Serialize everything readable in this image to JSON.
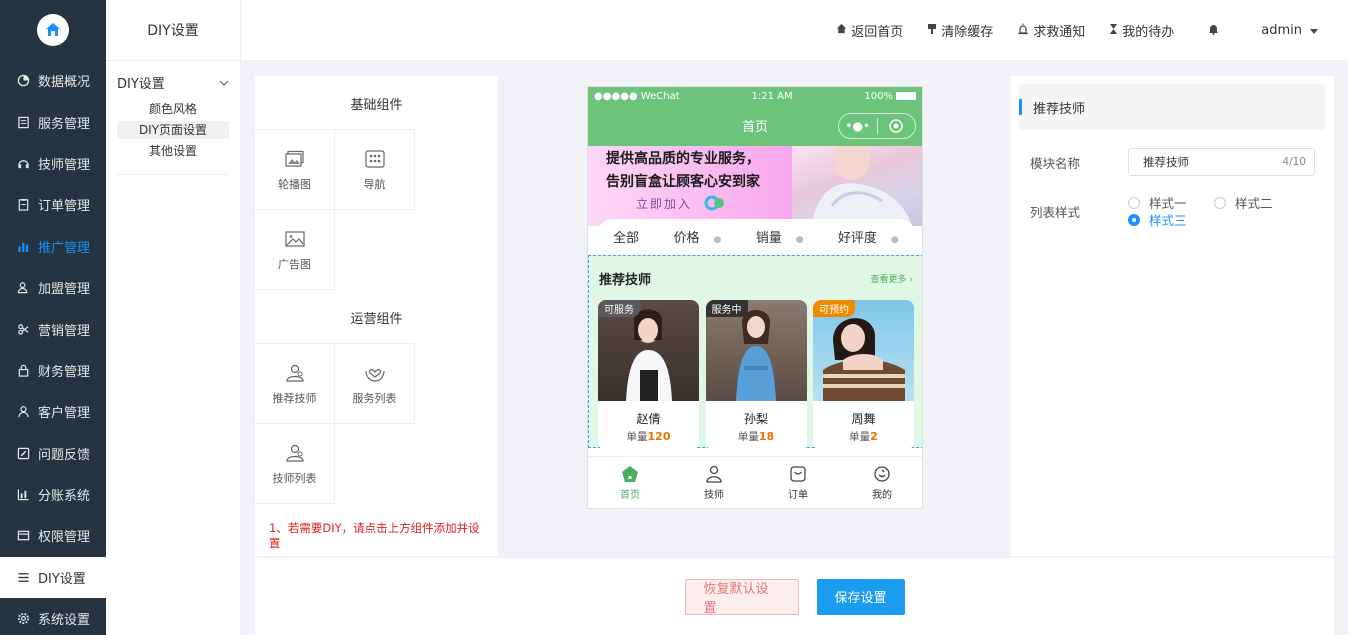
{
  "sidebar": {
    "items": [
      {
        "label": "数据概况",
        "icon": "pie-chart-icon"
      },
      {
        "label": "服务管理",
        "icon": "receipt-icon"
      },
      {
        "label": "技师管理",
        "icon": "headset-icon"
      },
      {
        "label": "订单管理",
        "icon": "clipboard-icon"
      },
      {
        "label": "推广管理",
        "icon": "bar-chart-icon"
      },
      {
        "label": "加盟管理",
        "icon": "user-group-icon"
      },
      {
        "label": "营销管理",
        "icon": "scissor-icon"
      },
      {
        "label": "财务管理",
        "icon": "lock-icon"
      },
      {
        "label": "客户管理",
        "icon": "user-icon"
      },
      {
        "label": "问题反馈",
        "icon": "edit-icon"
      },
      {
        "label": "分账系统",
        "icon": "chart-icon"
      },
      {
        "label": "权限管理",
        "icon": "card-icon"
      },
      {
        "label": "DIY设置",
        "icon": "menu-icon"
      },
      {
        "label": "系统设置",
        "icon": "gear-icon"
      }
    ]
  },
  "subnav": {
    "title": "DIY设置",
    "group": "DIY设置",
    "items": [
      "颜色风格",
      "DIY页面设置",
      "其他设置"
    ]
  },
  "topbar": {
    "home": "返回首页",
    "clear": "清除缓存",
    "help": "求救通知",
    "todo": "我的待办",
    "user": "admin"
  },
  "palette": {
    "basic_title": "基础组件",
    "basic": [
      "轮播图",
      "导航",
      "广告图"
    ],
    "ops_title": "运营组件",
    "ops": [
      "推荐技师",
      "服务列表",
      "技师列表"
    ],
    "note": "1、若需要DIY，请点击上方组件添加并设置"
  },
  "phone": {
    "carrier": "●●●●● WeChat",
    "time": "1:21 AM",
    "battery": "100%",
    "title": "首页",
    "banner_line1": "提供高品质的专业服务，",
    "banner_line2": "告别盲盒让顾客心安到家",
    "banner_cta": "立即加入",
    "filters": [
      "全部",
      "价格",
      "销量",
      "好评度"
    ],
    "rec_title": "推荐技师",
    "rec_more": "查看更多 ›",
    "orders_label": "单量",
    "cards": [
      {
        "badge": "可服务",
        "badge_color": "#5a5a5a",
        "name": "赵倩",
        "orders": "120"
      },
      {
        "badge": "服务中",
        "badge_color": "#333333",
        "name": "孙梨",
        "orders": "18"
      },
      {
        "badge": "可预约",
        "badge_color": "#f08a00",
        "name": "周舞",
        "orders": "2"
      }
    ],
    "tabs": [
      "首页",
      "技师",
      "订单",
      "我的"
    ]
  },
  "props": {
    "header": "推荐技师",
    "name_label": "模块名称",
    "name_value": "推荐技师",
    "name_count": "4/10",
    "style_label": "列表样式",
    "styles": [
      "样式一",
      "样式二",
      "样式三"
    ]
  },
  "footer": {
    "reset": "恢复默认设置",
    "save": "保存设置"
  }
}
